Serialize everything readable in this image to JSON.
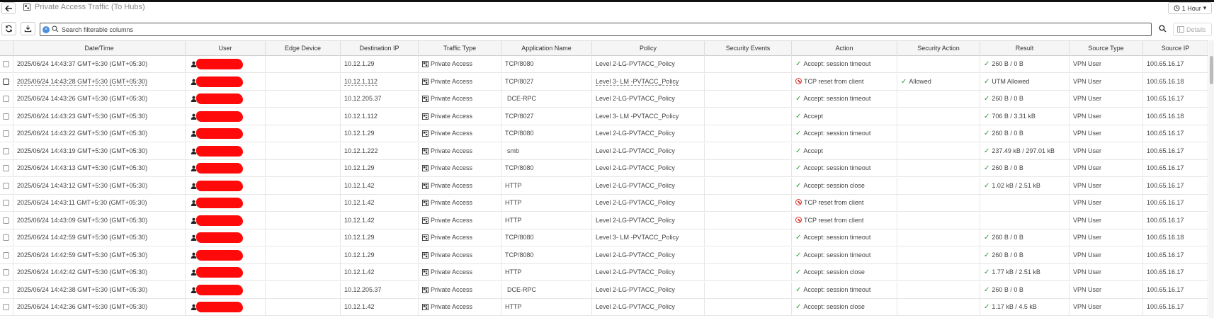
{
  "header": {
    "title": "Private Access Traffic (To Hubs)",
    "time_range": "1 Hour"
  },
  "toolbar": {
    "search_placeholder": "Search filterable columns",
    "details_label": "Details"
  },
  "columns": [
    "Date/Time",
    "User",
    "Edge Device",
    "Destination IP",
    "Traffic Type",
    "Application Name",
    "Policy",
    "Security Events",
    "Action",
    "Security Action",
    "Result",
    "Source Type",
    "Source IP"
  ],
  "rows": [
    {
      "datetime": "2025/06/24 14:43:37 GMT+5:30 (GMT+05:30)",
      "dest_ip": "10.12.1.29",
      "traffic": "Private Access",
      "app": "TCP/8080",
      "policy": "Level 2-LG-PVTACC_Policy",
      "action": "Accept: session timeout",
      "action_type": "accept",
      "sec_action": "",
      "result": "260 B / 0 B",
      "result_ok": true,
      "source_type": "VPN User",
      "source_ip": "100.65.16.17"
    },
    {
      "datetime": "2025/06/24 14:43:28 GMT+5:30 (GMT+05:30)",
      "dest_ip": "10.12.1.112",
      "traffic": "Private Access",
      "app": "TCP/8027",
      "policy": "Level 3- LM -PVTACC_Policy",
      "action": "TCP reset from client",
      "action_type": "deny",
      "sec_action": "Allowed",
      "result": "UTM Allowed",
      "result_ok": true,
      "source_type": "VPN User",
      "source_ip": "100.65.16.18"
    },
    {
      "datetime": "2025/06/24 14:43:26 GMT+5:30 (GMT+05:30)",
      "dest_ip": "10.12.205.37",
      "traffic": "Private Access",
      "app": "DCE-RPC",
      "policy": "Level 2-LG-PVTACC_Policy",
      "action": "Accept: session timeout",
      "action_type": "accept",
      "sec_action": "",
      "result": "260 B / 0 B",
      "result_ok": true,
      "source_type": "VPN User",
      "source_ip": "100.65.16.17"
    },
    {
      "datetime": "2025/06/24 14:43:23 GMT+5:30 (GMT+05:30)",
      "dest_ip": "10.12.1.112",
      "traffic": "Private Access",
      "app": "TCP/8027",
      "policy": "Level 3- LM -PVTACC_Policy",
      "action": "Accept",
      "action_type": "accept",
      "sec_action": "",
      "result": "706 B / 3.31 kB",
      "result_ok": true,
      "source_type": "VPN User",
      "source_ip": "100.65.16.18"
    },
    {
      "datetime": "2025/06/24 14:43:22 GMT+5:30 (GMT+05:30)",
      "dest_ip": "10.12.1.29",
      "traffic": "Private Access",
      "app": "TCP/8080",
      "policy": "Level 2-LG-PVTACC_Policy",
      "action": "Accept: session timeout",
      "action_type": "accept",
      "sec_action": "",
      "result": "260 B / 0 B",
      "result_ok": true,
      "source_type": "VPN User",
      "source_ip": "100.65.16.17"
    },
    {
      "datetime": "2025/06/24 14:43:19 GMT+5:30 (GMT+05:30)",
      "dest_ip": "10.12.1.222",
      "traffic": "Private Access",
      "app": "smb",
      "policy": "Level 2-LG-PVTACC_Policy",
      "action": "Accept",
      "action_type": "accept",
      "sec_action": "",
      "result": "237.49 kB / 297.01 kB",
      "result_ok": true,
      "source_type": "VPN User",
      "source_ip": "100.65.16.17"
    },
    {
      "datetime": "2025/06/24 14:43:13 GMT+5:30 (GMT+05:30)",
      "dest_ip": "10.12.1.29",
      "traffic": "Private Access",
      "app": "TCP/8080",
      "policy": "Level 2-LG-PVTACC_Policy",
      "action": "Accept: session timeout",
      "action_type": "accept",
      "sec_action": "",
      "result": "260 B / 0 B",
      "result_ok": true,
      "source_type": "VPN User",
      "source_ip": "100.65.16.17"
    },
    {
      "datetime": "2025/06/24 14:43:12 GMT+5:30 (GMT+05:30)",
      "dest_ip": "10.12.1.42",
      "traffic": "Private Access",
      "app": "HTTP",
      "policy": "Level 2-LG-PVTACC_Policy",
      "action": "Accept: session close",
      "action_type": "accept",
      "sec_action": "",
      "result": "1.02 kB / 2.51 kB",
      "result_ok": true,
      "source_type": "VPN User",
      "source_ip": "100.65.16.17"
    },
    {
      "datetime": "2025/06/24 14:43:11 GMT+5:30 (GMT+05:30)",
      "dest_ip": "10.12.1.42",
      "traffic": "Private Access",
      "app": "HTTP",
      "policy": "Level 2-LG-PVTACC_Policy",
      "action": "TCP reset from client",
      "action_type": "deny",
      "sec_action": "",
      "result": "",
      "result_ok": false,
      "source_type": "VPN User",
      "source_ip": "100.65.16.17"
    },
    {
      "datetime": "2025/06/24 14:43:09 GMT+5:30 (GMT+05:30)",
      "dest_ip": "10.12.1.42",
      "traffic": "Private Access",
      "app": "HTTP",
      "policy": "Level 2-LG-PVTACC_Policy",
      "action": "TCP reset from client",
      "action_type": "deny",
      "sec_action": "",
      "result": "",
      "result_ok": false,
      "source_type": "VPN User",
      "source_ip": "100.65.16.17"
    },
    {
      "datetime": "2025/06/24 14:42:59 GMT+5:30 (GMT+05:30)",
      "dest_ip": "10.12.1.29",
      "traffic": "Private Access",
      "app": "TCP/8080",
      "policy": "Level 3- LM -PVTACC_Policy",
      "action": "Accept: session timeout",
      "action_type": "accept",
      "sec_action": "",
      "result": "260 B / 0 B",
      "result_ok": true,
      "source_type": "VPN User",
      "source_ip": "100.65.16.18"
    },
    {
      "datetime": "2025/06/24 14:42:59 GMT+5:30 (GMT+05:30)",
      "dest_ip": "10.12.1.29",
      "traffic": "Private Access",
      "app": "TCP/8080",
      "policy": "Level 2-LG-PVTACC_Policy",
      "action": "Accept: session timeout",
      "action_type": "accept",
      "sec_action": "",
      "result": "260 B / 0 B",
      "result_ok": true,
      "source_type": "VPN User",
      "source_ip": "100.65.16.17"
    },
    {
      "datetime": "2025/06/24 14:42:42 GMT+5:30 (GMT+05:30)",
      "dest_ip": "10.12.1.42",
      "traffic": "Private Access",
      "app": "HTTP",
      "policy": "Level 2-LG-PVTACC_Policy",
      "action": "Accept: session close",
      "action_type": "accept",
      "sec_action": "",
      "result": "1.77 kB / 2.51 kB",
      "result_ok": true,
      "source_type": "VPN User",
      "source_ip": "100.65.16.17"
    },
    {
      "datetime": "2025/06/24 14:42:38 GMT+5:30 (GMT+05:30)",
      "dest_ip": "10.12.205.37",
      "traffic": "Private Access",
      "app": "DCE-RPC",
      "policy": "Level 2-LG-PVTACC_Policy",
      "action": "Accept: session timeout",
      "action_type": "accept",
      "sec_action": "",
      "result": "260 B / 0 B",
      "result_ok": true,
      "source_type": "VPN User",
      "source_ip": "100.65.16.17"
    },
    {
      "datetime": "2025/06/24 14:42:36 GMT+5:30 (GMT+05:30)",
      "dest_ip": "10.12.1.42",
      "traffic": "Private Access",
      "app": "HTTP",
      "policy": "Level 2-LG-PVTACC_Policy",
      "action": "Accept: session close",
      "action_type": "accept",
      "sec_action": "",
      "result": "1.17 kB / 4.5 kB",
      "result_ok": true,
      "source_type": "VPN User",
      "source_ip": "100.65.16.17"
    }
  ]
}
